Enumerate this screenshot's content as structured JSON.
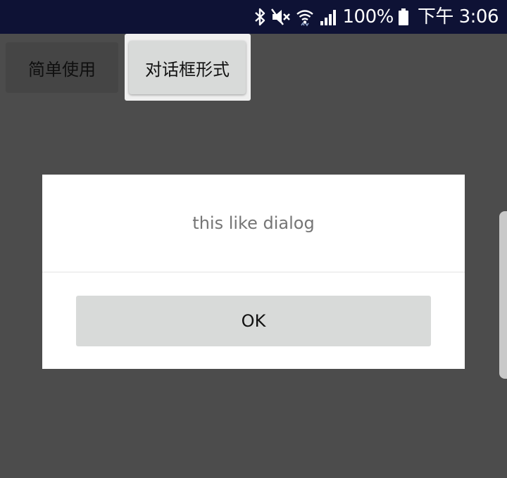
{
  "status_bar": {
    "icons": [
      "bluetooth-icon",
      "mute-icon",
      "wifi-icon",
      "signal-icon",
      "battery-icon"
    ],
    "battery": "100%",
    "time": "下午 3:06"
  },
  "app": {
    "buttons": [
      {
        "label": "简单使用"
      },
      {
        "label": "对话框形式"
      }
    ]
  },
  "dialog": {
    "message": "this like dialog",
    "ok_label": "OK"
  },
  "colors": {
    "status_bar_bg": "#0e1235",
    "scrim": "#4c4c4c",
    "dialog_bg": "#ffffff",
    "button_bg": "#d8dad9",
    "message_text": "#757575"
  }
}
